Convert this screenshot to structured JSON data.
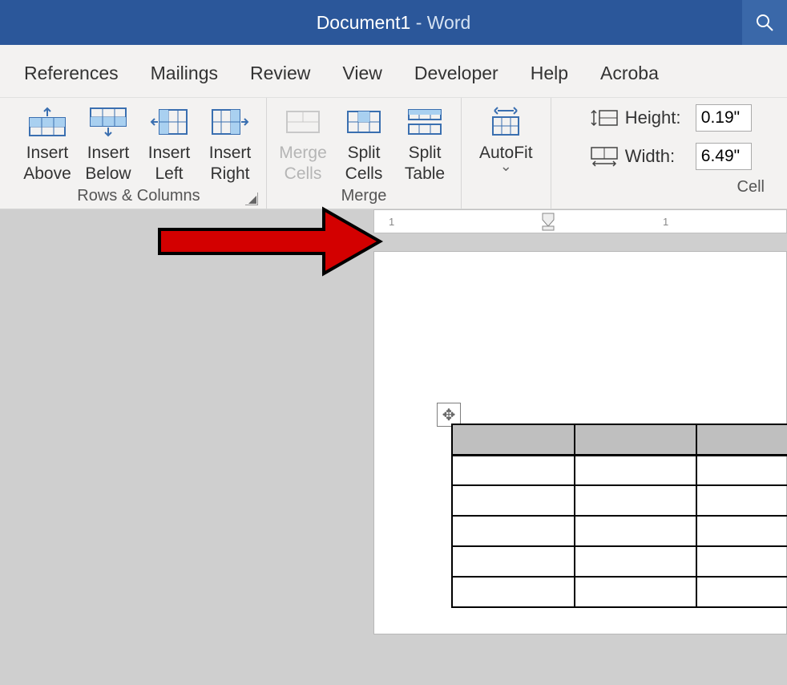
{
  "title": {
    "document": "Document1",
    "separator": "  -  ",
    "app": "Word"
  },
  "tabs": [
    "References",
    "Mailings",
    "Review",
    "View",
    "Developer",
    "Help",
    "Acroba"
  ],
  "rows_columns": {
    "label": "Rows & Columns",
    "buttons": {
      "insert_above": {
        "line1": "Insert",
        "line2": "Above"
      },
      "insert_below": {
        "line1": "Insert",
        "line2": "Below"
      },
      "insert_left": {
        "line1": "Insert",
        "line2": "Left"
      },
      "insert_right": {
        "line1": "Insert",
        "line2": "Right"
      }
    }
  },
  "merge": {
    "label": "Merge",
    "buttons": {
      "merge_cells": {
        "line1": "Merge",
        "line2": "Cells"
      },
      "split_cells": {
        "line1": "Split",
        "line2": "Cells"
      },
      "split_table": {
        "line1": "Split",
        "line2": "Table"
      }
    }
  },
  "autofit": {
    "label": "AutoFit"
  },
  "cell_size": {
    "label": "Cell",
    "height_label": "Height:",
    "height_value": "0.19\"",
    "width_label": "Width:",
    "width_value": "6.49\""
  },
  "ruler": {
    "left_num": "1",
    "right_num": "1"
  },
  "doc_table": {
    "rows": 6,
    "cols": 3
  }
}
